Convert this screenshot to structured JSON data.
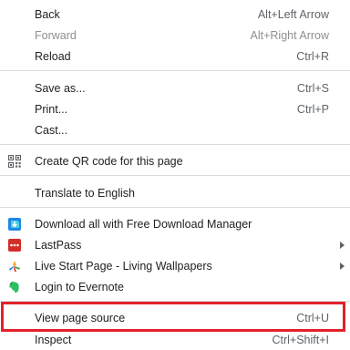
{
  "menu": {
    "back": {
      "label": "Back",
      "shortcut": "Alt+Left Arrow"
    },
    "forward": {
      "label": "Forward",
      "shortcut": "Alt+Right Arrow"
    },
    "reload": {
      "label": "Reload",
      "shortcut": "Ctrl+R"
    },
    "save_as": {
      "label": "Save as...",
      "shortcut": "Ctrl+S"
    },
    "print": {
      "label": "Print...",
      "shortcut": "Ctrl+P"
    },
    "cast": {
      "label": "Cast..."
    },
    "qr": {
      "label": "Create QR code for this page",
      "icon": "qr-code-icon"
    },
    "translate": {
      "label": "Translate to English"
    },
    "extensions": [
      {
        "label": "Download all with Free Download Manager",
        "icon": "free-download-manager-icon",
        "submenu": false
      },
      {
        "label": "LastPass",
        "icon": "lastpass-icon",
        "submenu": true
      },
      {
        "label": "Live Start Page - Living Wallpapers",
        "icon": "live-start-page-icon",
        "submenu": true
      },
      {
        "label": "Login to Evernote",
        "icon": "evernote-icon",
        "submenu": false
      }
    ],
    "view_source": {
      "label": "View page source",
      "shortcut": "Ctrl+U"
    },
    "inspect": {
      "label": "Inspect",
      "shortcut": "Ctrl+Shift+I"
    }
  },
  "colors": {
    "highlight_border": "#e3202a",
    "disabled_text": "#8d8f92",
    "separator": "#dadce0"
  }
}
